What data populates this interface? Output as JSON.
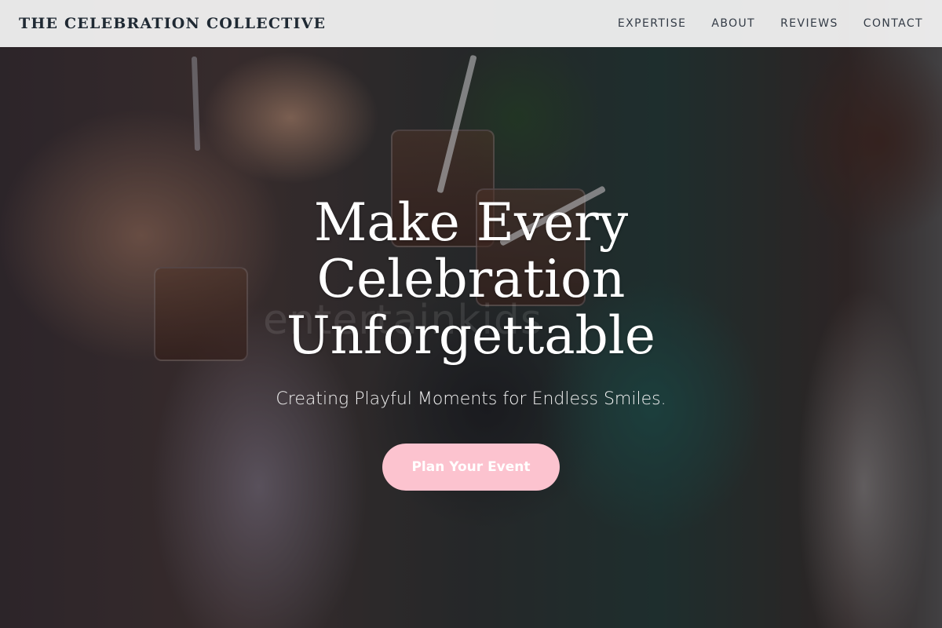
{
  "header": {
    "brand": "THE CELEBRATION COLLECTIVE",
    "nav": [
      {
        "label": "EXPERTISE"
      },
      {
        "label": "ABOUT"
      },
      {
        "label": "REVIEWS"
      },
      {
        "label": "CONTACT"
      }
    ]
  },
  "hero": {
    "title": "Make Every Celebration Unforgettable",
    "subtitle": "Creating Playful Moments for Endless Smiles.",
    "cta_label": "Plan Your Event",
    "watermark": "entertainkids",
    "image_alt_icon": "party-photo"
  },
  "colors": {
    "cta_background": "#fcc3cf",
    "nav_background": "#f7f7f7",
    "brand_text": "#1f2933"
  }
}
